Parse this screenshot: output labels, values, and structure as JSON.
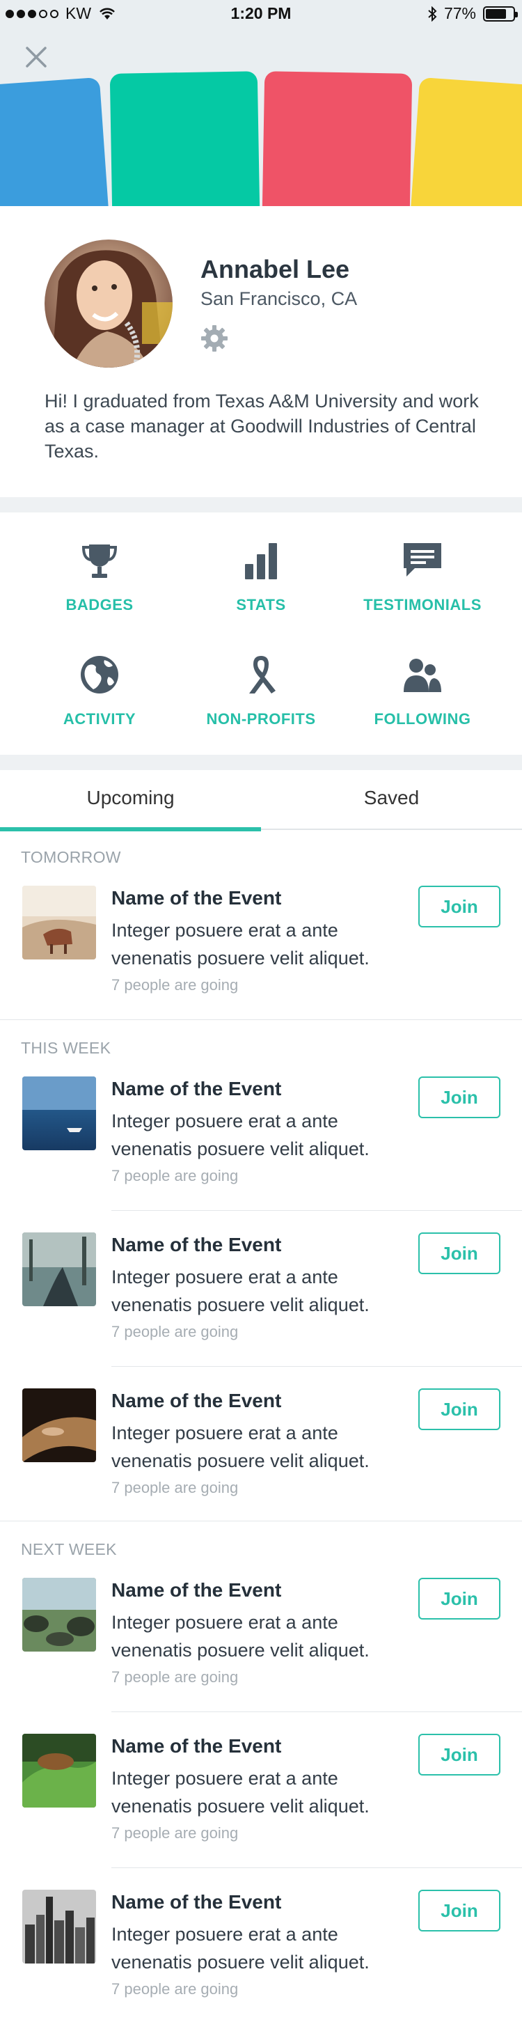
{
  "status_bar": {
    "carrier": "KW",
    "time": "1:20 PM",
    "battery_percent": "77%",
    "battery_level": 0.77
  },
  "header": {
    "close_icon": "close-icon",
    "card_colors": [
      "#3b9ddd",
      "#05c9a4",
      "#ef5367",
      "#f8d53a"
    ]
  },
  "profile": {
    "name": "Annabel Lee",
    "location": "San Francisco, CA",
    "bio": "Hi! I graduated from Texas A&M University and work as a case manager at Goodwill Industries of Central Texas."
  },
  "menu": [
    {
      "label": "BADGES",
      "icon": "trophy-icon"
    },
    {
      "label": "STATS",
      "icon": "bar-chart-icon"
    },
    {
      "label": "TESTIMONIALS",
      "icon": "chat-bubble-icon"
    },
    {
      "label": "ACTIVITY",
      "icon": "globe-icon"
    },
    {
      "label": "NON-PROFITS",
      "icon": "ribbon-icon"
    },
    {
      "label": "FOLLOWING",
      "icon": "people-icon"
    }
  ],
  "tabs": {
    "upcoming": "Upcoming",
    "saved": "Saved"
  },
  "sections": {
    "tomorrow": "TOMORROW",
    "this_week": "THIS WEEK",
    "next_week": "NEXT WEEK"
  },
  "events": [
    {
      "title": "Name of the Event",
      "description": "Integer posuere erat a ante venenatis posuere velit aliquet.",
      "going": "7 people are going",
      "join": "Join"
    },
    {
      "title": "Name of the Event",
      "description": "Integer posuere erat a ante venenatis posuere velit aliquet.",
      "going": "7 people are going",
      "join": "Join"
    },
    {
      "title": "Name of the Event",
      "description": "Integer posuere erat a ante venenatis posuere velit aliquet.",
      "going": "7 people are going",
      "join": "Join"
    },
    {
      "title": "Name of the Event",
      "description": "Integer posuere erat a ante venenatis posuere velit aliquet.",
      "going": "7 people are going",
      "join": "Join"
    },
    {
      "title": "Name of the Event",
      "description": "Integer posuere erat a ante venenatis posuere velit aliquet.",
      "going": "7 people are going",
      "join": "Join"
    },
    {
      "title": "Name of the Event",
      "description": "Integer posuere erat a ante venenatis posuere velit aliquet.",
      "going": "7 people are going",
      "join": "Join"
    },
    {
      "title": "Name of the Event",
      "description": "Integer posuere erat a ante venenatis posuere velit aliquet.",
      "going": "7 people are going",
      "join": "Join"
    }
  ],
  "colors": {
    "accent": "#2bc0aa",
    "icon": "#4a5966"
  }
}
